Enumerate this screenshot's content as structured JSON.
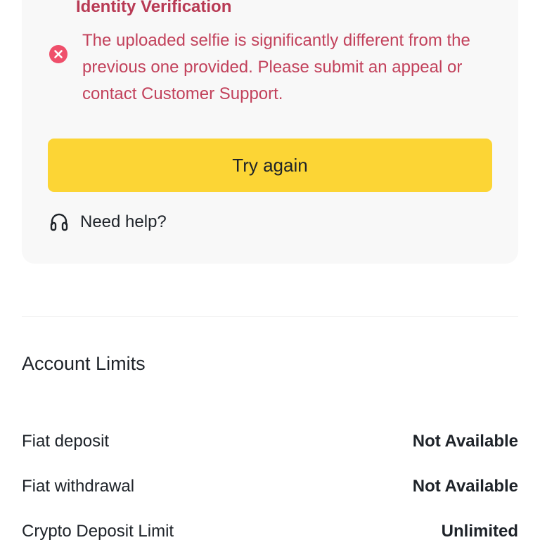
{
  "verification": {
    "title": "Identity Verification",
    "error_message": "The uploaded selfie is significantly different from the previous one provided. Please submit an appeal or contact Customer Support.",
    "error_icon": "error-x-circle-icon",
    "error_color": "#c2415b",
    "retry_button_label": "Try again",
    "retry_button_color": "#fcd535",
    "help_icon": "headset-icon",
    "help_label": "Need help?"
  },
  "account_limits": {
    "title": "Account Limits",
    "rows": [
      {
        "label": "Fiat deposit",
        "value": "Not Available"
      },
      {
        "label": "Fiat withdrawal",
        "value": "Not Available"
      },
      {
        "label": "Crypto Deposit Limit",
        "value": "Unlimited"
      }
    ]
  }
}
